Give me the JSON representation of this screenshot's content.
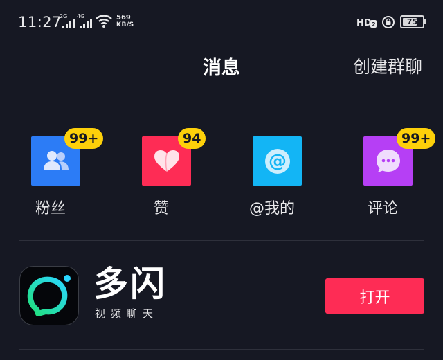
{
  "colors": {
    "background": "#161823",
    "divider": "#2e303b",
    "badge": "#fdd00a",
    "primary_button": "#fe2c55",
    "fans_tile": "#2c7cf6",
    "likes_tile": "#fe2c55",
    "mentions_tile": "#13b5f5",
    "comments_tile": "#b63ff5"
  },
  "status_bar": {
    "time": "11:27",
    "network_1": "2G",
    "network_2": "4G",
    "speed_value": "569",
    "speed_unit": "KB/S",
    "hd_label": "HD",
    "hd_sub": "2",
    "battery_level": "75",
    "battery_fraction": 0.75,
    "icons": [
      "signal-icon",
      "wifi-icon",
      "hd-icon",
      "rotation-lock-icon",
      "battery-icon"
    ]
  },
  "header": {
    "title": "消息",
    "action": "创建群聊"
  },
  "entries": [
    {
      "label": "粉丝",
      "badge": "99+",
      "icon": "fans-icon"
    },
    {
      "label": "赞",
      "badge": "94",
      "icon": "heart-icon"
    },
    {
      "label": "@我的",
      "badge": "",
      "icon": "at-icon"
    },
    {
      "label": "评论",
      "badge": "99+",
      "icon": "comment-icon"
    }
  ],
  "promo": {
    "app_name": "多闪",
    "slogan": "视频聊天",
    "button_label": "打开",
    "icon": "duoshan-app-icon"
  }
}
